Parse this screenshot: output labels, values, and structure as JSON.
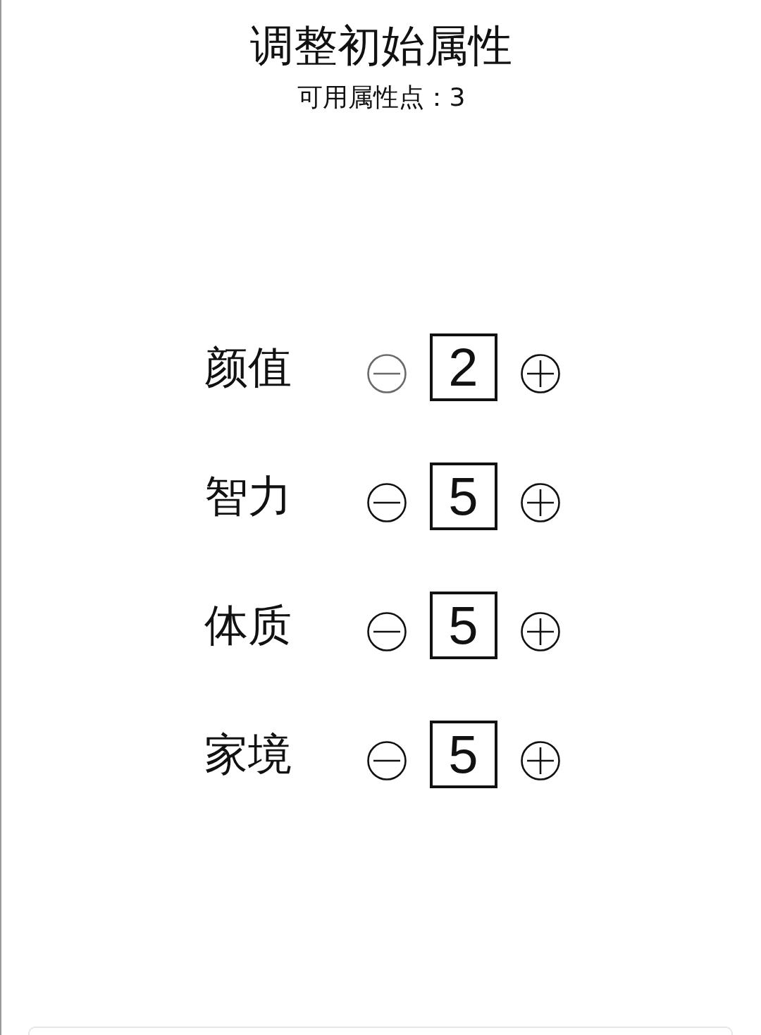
{
  "title": "调整初始属性",
  "subtitle": "可用属性点：3",
  "attributes": [
    {
      "label": "颜值",
      "value": "2",
      "decrease_disabled": true
    },
    {
      "label": "智力",
      "value": "5",
      "decrease_disabled": false
    },
    {
      "label": "体质",
      "value": "5",
      "decrease_disabled": false
    },
    {
      "label": "家境",
      "value": "5",
      "decrease_disabled": false
    }
  ]
}
